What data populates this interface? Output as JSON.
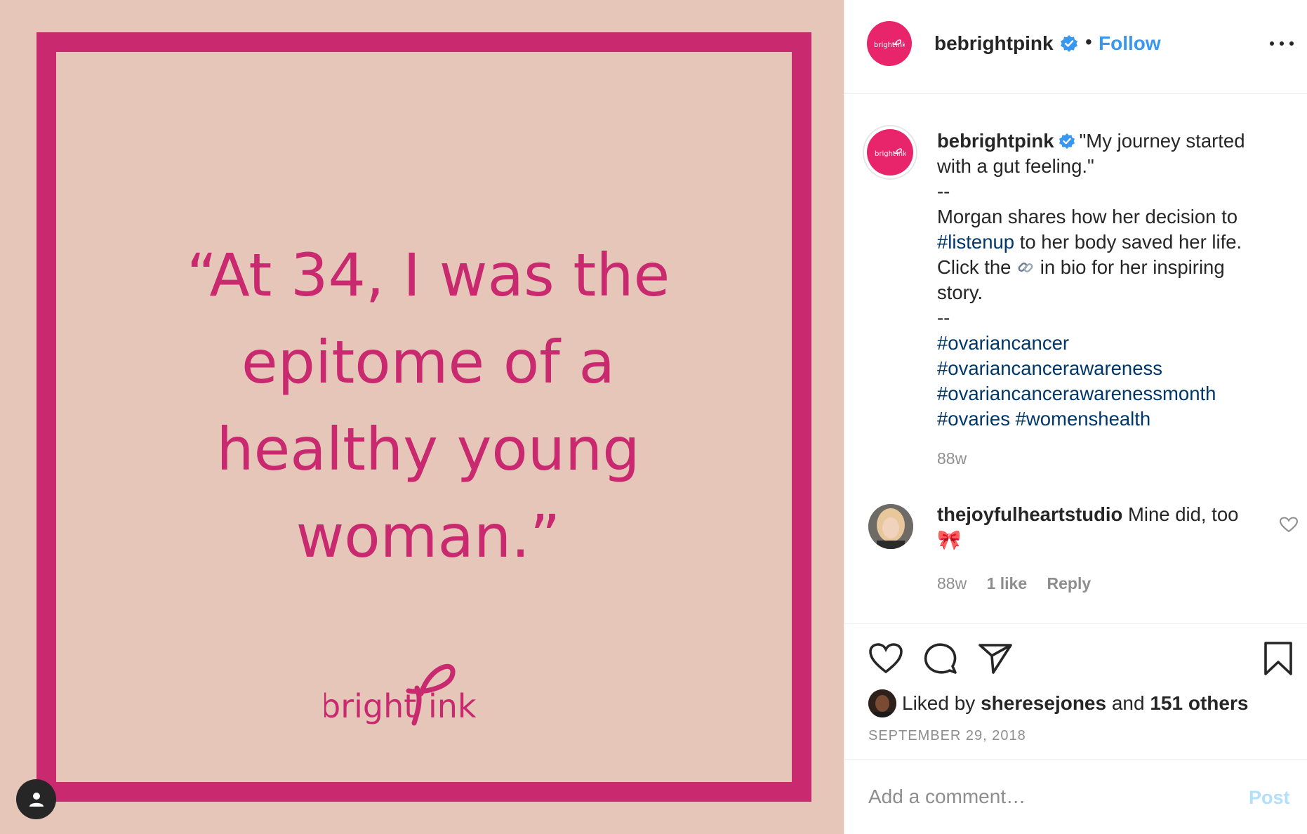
{
  "post_image": {
    "quote_lines": [
      "“At 34, I was the",
      "epitome of a",
      "healthy young",
      "woman.”"
    ],
    "logo_text": "bright Pink",
    "accent_color": "#c9296f",
    "background_color": "#e6c6b9",
    "user_tag_icon": "person-icon"
  },
  "header": {
    "username": "bebrightpink",
    "verified": true,
    "separator": "•",
    "follow_label": "Follow",
    "more_icon": "more-options-icon",
    "avatar_text": "bright Pink"
  },
  "caption": {
    "username": "bebrightpink",
    "text_line1": "\"My journey started",
    "text_line2": "with a gut feeling.\"",
    "sep1": "--",
    "body_line1": "Morgan shares how her decision to",
    "hashtag_listenup": "#listenup",
    "body_line2_rest": " to her body saved her life.",
    "body_line3_a": "Click the ",
    "link_icon": "link-icon",
    "body_line3_b": " in bio for her inspiring",
    "body_line4": "story.",
    "sep2": "--",
    "hashtags": [
      "#ovariancancer",
      "#ovariancancerawareness",
      "#ovariancancerawarenessmonth"
    ],
    "hashtag_last_a": "#ovaries",
    "hashtag_last_b": "#womenshealth",
    "time": "88w"
  },
  "comment": {
    "username": "thejoyfulheartstudio",
    "text": " Mine did, too",
    "emoji": "🎀",
    "time": "88w",
    "likes": "1 like",
    "reply_label": "Reply"
  },
  "actions": {
    "like_icon": "heart-icon",
    "comment_icon": "comment-icon",
    "share_icon": "share-icon",
    "save_icon": "bookmark-icon",
    "liked_by_prefix": "Liked by ",
    "liked_by_user": "sheresejones",
    "liked_by_middle": " and ",
    "liked_by_others": "151 others",
    "date": "SEPTEMBER 29, 2018"
  },
  "add_comment": {
    "placeholder": "Add a comment…",
    "post_label": "Post"
  }
}
